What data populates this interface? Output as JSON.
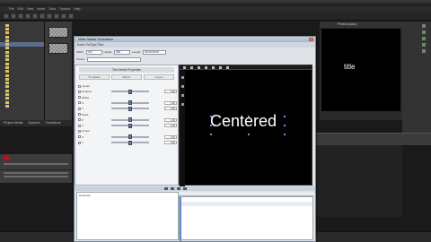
{
  "host": {
    "menu": [
      "File",
      "Edit",
      "View",
      "Insert",
      "Tools",
      "Options",
      "Help"
    ],
    "tree_items": [
      "",
      "",
      "",
      "",
      "",
      "",
      "",
      "",
      "",
      "",
      "",
      "",
      "",
      "",
      "",
      "",
      "",
      "",
      "",
      "",
      "",
      ""
    ],
    "left_tabs": [
      "Project Media",
      "Explorer",
      "Transitions"
    ],
    "preview_header": "Preview (Auto)",
    "preview_text": "title",
    "status": ""
  },
  "dialog": {
    "title": "Video Media Generators",
    "subtitle": "Event: ProType Titler",
    "close_label": "x",
    "fields": {
      "width_label": "Width:",
      "width_value": "720",
      "height_label": "Height:",
      "height_value": "480",
      "length_label": "Length:",
      "length_value": "00:00:05;00",
      "preset_label": "Preset:",
      "preset_value": ""
    },
    "plugin_title": "Text Media Properties",
    "preset_tabs": [
      "Templates",
      "Effects",
      "Layout"
    ],
    "params": [
      {
        "label": "Layout",
        "value": ""
      },
      {
        "label": "Rotation",
        "value": "0.00"
      },
      {
        "label": "Offset",
        "value": ""
      },
      {
        "label": "X",
        "value": "0.00"
      },
      {
        "label": "Y",
        "value": "0.00"
      },
      {
        "label": "Scale",
        "value": ""
      },
      {
        "label": "X",
        "value": "1.00"
      },
      {
        "label": "Y",
        "value": "1.00"
      },
      {
        "label": "Center",
        "value": ""
      },
      {
        "label": "X",
        "value": "0.00"
      },
      {
        "label": "Y",
        "value": "0.00"
      }
    ],
    "centered_text": "Centered",
    "kf_row_label": "Centered"
  }
}
